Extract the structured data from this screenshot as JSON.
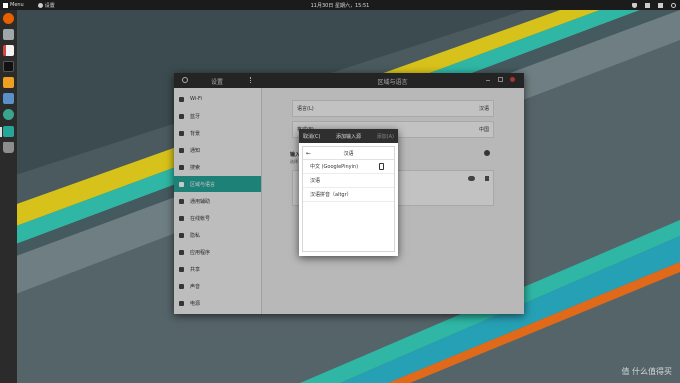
{
  "colors": {
    "accent": "#26a69a",
    "bar_bg": "#1b1b1b",
    "window_head": "#2f2f2f",
    "close": "#d64541"
  },
  "topbar": {
    "menu_label": "Menu",
    "app_label": "设置",
    "clock": "11月30日 星期六，15:51"
  },
  "dock": {
    "items": [
      "firefox-icon",
      "files-icon",
      "editor-icon",
      "terminal-icon",
      "package-icon",
      "screen-icon",
      "settings-icon",
      "shell-icon",
      "trash-icon"
    ]
  },
  "window": {
    "sidebar_title": "设置",
    "main_title": "区域与语言",
    "sidebar_items": [
      {
        "label": "Wi-Fi",
        "icon": "wifi-icon"
      },
      {
        "label": "蓝牙",
        "icon": "bluetooth-icon"
      },
      {
        "label": "背景",
        "icon": "background-icon"
      },
      {
        "label": "通知",
        "icon": "notification-icon"
      },
      {
        "label": "搜索",
        "icon": "search-icon"
      },
      {
        "label": "区域与语言",
        "icon": "region-icon"
      },
      {
        "label": "通用辅助",
        "icon": "accessibility-icon"
      },
      {
        "label": "在线帐号",
        "icon": "online-accounts-icon"
      },
      {
        "label": "隐私",
        "icon": "privacy-icon"
      },
      {
        "label": "应用程序",
        "icon": "applications-icon"
      },
      {
        "label": "共享",
        "icon": "sharing-icon"
      },
      {
        "label": "声音",
        "icon": "sound-icon"
      },
      {
        "label": "电源",
        "icon": "power-icon"
      }
    ],
    "language_row": {
      "label": "语言(L)",
      "value": "汉语"
    },
    "formats_row": {
      "label": "格式(F)",
      "value": "中国"
    },
    "input_section": {
      "title": "输入源",
      "subtitle": "选择"
    }
  },
  "dialog": {
    "cancel_label": "取消(C)",
    "title": "添加输入源",
    "add_label": "添加(A)",
    "search_value": "汉语",
    "items": [
      "中文 (GooglePinyin)",
      "汉语",
      "汉语拼音（altgr）"
    ]
  },
  "watermark": "值 什么值得买"
}
